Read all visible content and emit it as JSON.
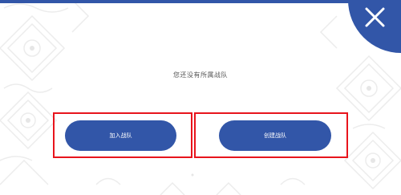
{
  "message": "您还没有所属战队",
  "buttons": {
    "join_label": "加入战队",
    "create_label": "创建战队"
  },
  "icons": {
    "close": "close-icon"
  },
  "colors": {
    "primary_blue": "#3256a8",
    "highlight_red": "#e8141c",
    "pattern_gray": "#e9e9e9"
  }
}
